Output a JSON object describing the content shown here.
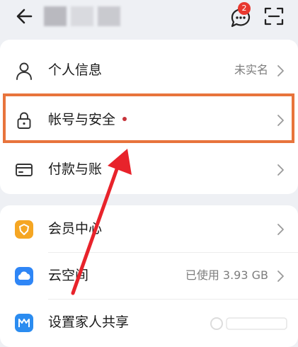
{
  "header": {
    "back_icon": "back-arrow-icon",
    "message_badge": "2",
    "message_icon": "message-bubble-icon",
    "scan_icon": "scan-icon"
  },
  "settings_group_1": [
    {
      "label": "个人信息",
      "value": "未实名",
      "icon": "person-icon"
    },
    {
      "label": "帐号与安全",
      "value": "",
      "icon": "lock-icon",
      "has_red_dot": true
    },
    {
      "label": "付款与账",
      "value": "",
      "icon": "card-icon"
    }
  ],
  "settings_group_2": [
    {
      "label": "会员中心",
      "value": "",
      "icon": "member-shield-icon"
    },
    {
      "label": "云空间",
      "value": "已使用 3.93 GB",
      "icon": "cloud-icon"
    },
    {
      "label": "设置家人共享",
      "value": "",
      "icon": "family-share-icon"
    }
  ],
  "colors": {
    "highlight_border": "#e8743c",
    "annotation_arrow": "#e8232b",
    "badge": "#e8382f",
    "member_icon": "#f5a623",
    "cloud_icon": "#2f86f6",
    "family_icon": "#2b8cf0"
  }
}
